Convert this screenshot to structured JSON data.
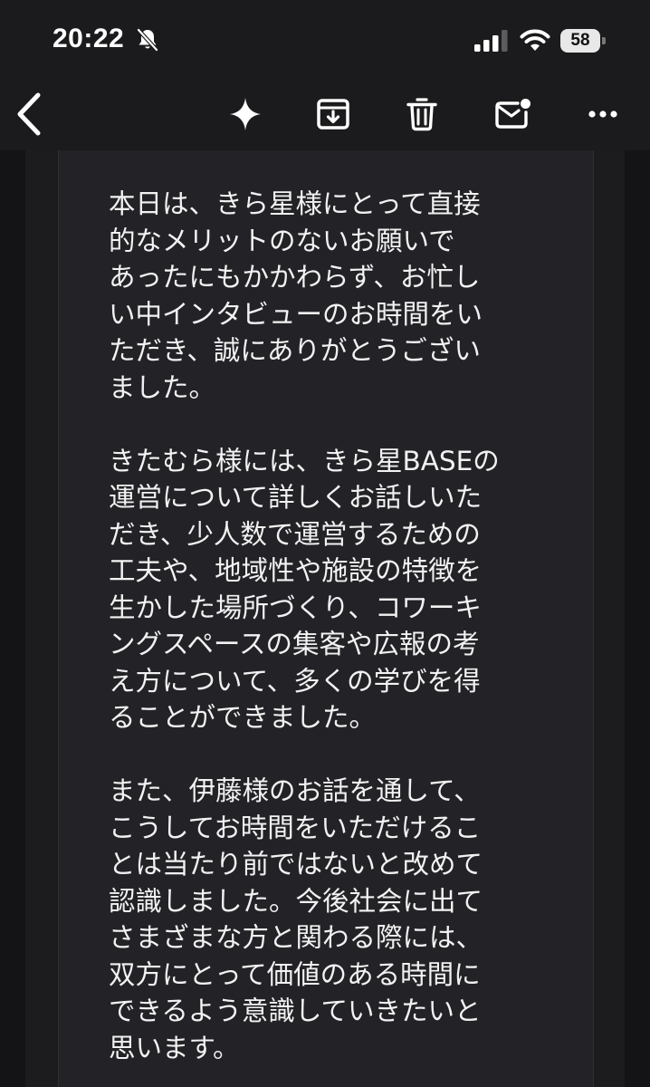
{
  "status_bar": {
    "time": "20:22",
    "battery_level": "58",
    "icons": [
      "bell-slash-icon",
      "cellular-signal-icon",
      "wifi-icon",
      "battery-icon"
    ]
  },
  "toolbar": {
    "icons": [
      "back-chevron-icon",
      "sparkle-icon",
      "archive-icon",
      "trash-icon",
      "mark-unread-icon",
      "more-icon"
    ]
  },
  "email_body": {
    "paragraph1": [
      "本日は、きら星様にとって直接",
      "的なメリットのないお願いで",
      "あったにもかかわらず、お忙し",
      "い中インタビューのお時間をい",
      "ただき、誠にありがとうござい",
      "ました。"
    ],
    "paragraph2": [
      "きたむら様には、きら星BASEの",
      "運営について詳しくお話しいた",
      "だき、少人数で運営するための",
      "工夫や、地域性や施設の特徴を",
      "生かした場所づくり、コワーキ",
      "ングスペースの集客や広報の考",
      "え方について、多くの学びを得",
      "ることができました。"
    ],
    "paragraph3": [
      "また、伊藤様のお話を通して、",
      "こうしてお時間をいただけるこ",
      "とは当たり前ではないと改めて",
      "認識しました。今後社会に出て",
      "さまざまな方と関わる際には、",
      "双方にとって価値のある時間に",
      "できるよう意識していきたいと",
      "思います。"
    ]
  },
  "colors": {
    "background": "#141416",
    "card": "#232327",
    "text": "#f2f2f2"
  }
}
